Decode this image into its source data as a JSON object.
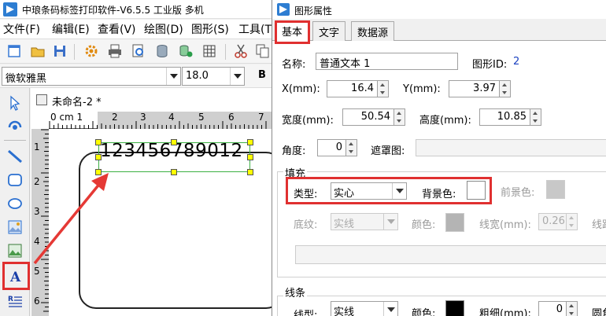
{
  "app": {
    "title": "中琅条码标签打印软件-V6.5.5 工业版 多机",
    "menu": [
      "文件(F)",
      "编辑(E)",
      "查看(V)",
      "绘图(D)",
      "图形(S)",
      "工具(T"
    ],
    "font_name": "微软雅黑",
    "font_size": "18.0",
    "bold_label": "B",
    "doc_tab": "未命名-2 *",
    "ruler_h_labels": [
      "0 cm 1",
      "2",
      "3",
      "4",
      "5",
      "6",
      "7"
    ],
    "ruler_v_labels": [
      "1",
      "2",
      "3",
      "4",
      "5",
      "6"
    ],
    "canvas_text": "123456789012"
  },
  "dialog": {
    "title": "图形属性",
    "tabs": [
      "基本",
      "文字",
      "数据源"
    ],
    "name_label": "名称:",
    "name_value": "普通文本 1",
    "shape_id_label": "图形ID:",
    "shape_id_value": "2",
    "x_label": "X(mm):",
    "x_value": "16.4",
    "y_label": "Y(mm):",
    "y_value": "3.97",
    "width_label": "宽度(mm):",
    "width_value": "50.54",
    "height_label": "高度(mm):",
    "height_value": "10.85",
    "angle_label": "角度:",
    "angle_value": "0",
    "mask_label": "遮罩图:",
    "fill": {
      "group_label": "填充",
      "type_label": "类型:",
      "type_value": "实心",
      "bg_label": "背景色:",
      "bg_color": "#ffffff",
      "fg_label": "前景色:",
      "fg_color": "#c8c8c8",
      "pattern_label": "底纹:",
      "pattern_value": "实线",
      "color_label": "颜色:",
      "color_value": "#b4b4b4",
      "line_width_label": "线宽(mm):",
      "line_width_value": "0.26",
      "extra_label": "线距"
    },
    "line": {
      "group_label": "线条",
      "type_label": "线型:",
      "type_value": "实线",
      "color_label": "颜色:",
      "color_value": "#000000",
      "thickness_label": "粗细(mm):",
      "thickness_value": "0",
      "extra_label": "圆角"
    }
  }
}
